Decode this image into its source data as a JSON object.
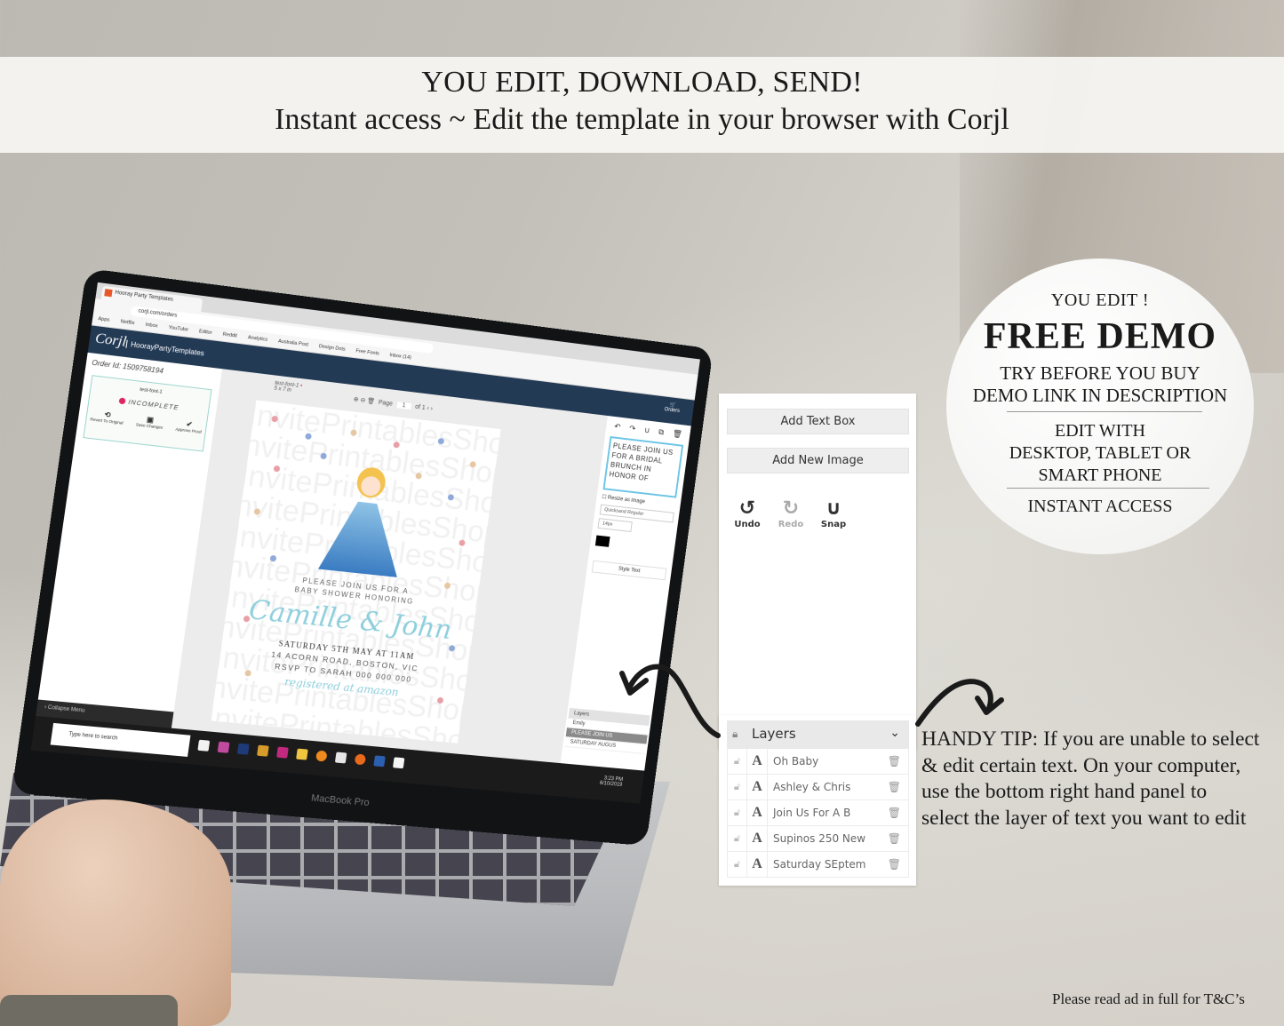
{
  "banner": {
    "line1": "YOU EDIT, DOWNLOAD, SEND!",
    "line2": "Instant access ~ Edit the template in your browser with Corjl"
  },
  "badge": {
    "line1": "YOU EDIT !",
    "line2": "FREE DEMO",
    "line3": "TRY BEFORE YOU BUY",
    "line4": "DEMO LINK IN DESCRIPTION",
    "line5": "EDIT WITH",
    "line6": "DESKTOP, TABLET OR",
    "line7": "SMART PHONE",
    "line8": "INSTANT ACCESS"
  },
  "editor_panel": {
    "add_text_box": "Add Text Box",
    "add_new_image": "Add New Image",
    "tools": [
      {
        "icon": "undo-icon",
        "label": "Undo",
        "enabled": true
      },
      {
        "icon": "redo-icon",
        "label": "Redo",
        "enabled": false
      },
      {
        "icon": "magnet-icon",
        "label": "Snap",
        "enabled": true
      }
    ]
  },
  "layers_panel": {
    "title": "Layers",
    "rows": [
      {
        "name": "Oh Baby"
      },
      {
        "name": "Ashley & Chris"
      },
      {
        "name": "Join Us For A B"
      },
      {
        "name": "Supinos 250 New"
      },
      {
        "name": "Saturday SEptem"
      }
    ]
  },
  "tip": {
    "lines": [
      "HANDY TIP: If you are unable to select",
      "& edit certain text. On your computer,",
      "use the bottom right hand panel to",
      "select the layer of text you want to edit"
    ]
  },
  "terms": "Please read ad in full for T&C’s",
  "laptop_screen": {
    "app_logo": "Corjl",
    "store_name": "HoorayPartyTemplates",
    "orders_label": "Orders",
    "order_id": "Order Id: 1509758194",
    "status_card": {
      "file_name": "test-font-1",
      "status": "INCOMPLETE",
      "actions": [
        "Revert To Original",
        "Save Changes",
        "Approve Proof"
      ]
    },
    "doc_title": "test-font-1",
    "doc_size": "5 x 7 in",
    "page_label": "Page",
    "page_current": "1",
    "page_total": "of 1",
    "collapse_menu": "Collapse Menu",
    "taskbar_search": "Type here to search",
    "clock_time": "3:23 PM",
    "clock_date": "6/10/2019",
    "brand": "MacBook Pro",
    "right_tools": {
      "icons": [
        "Undo",
        "Redo",
        "Snap",
        "Duplicate",
        "Delete"
      ],
      "text_box": "PLEASE JOIN US FOR A BRIDAL BRUNCH IN HONOR OF",
      "resize_label": "Resize as image",
      "font": "Quicksand Regular",
      "size": "14px",
      "style_text": "Style Text",
      "layers_title": "Layers",
      "layers": [
        "Emily",
        "PLEASE JOIN US",
        "SATURDAY AUGUS"
      ]
    },
    "invite": {
      "watermark": "InvitePrintablesShop",
      "line1": "PLEASE JOIN US FOR A",
      "line2": "BABY SHOWER HONORING",
      "names": "Camille & John",
      "line3": "SATURDAY 5TH MAY AT 11AM",
      "line4": "14 ACORN ROAD, BOSTON, VIC",
      "line5": "RSVP TO SARAH 000 000 000",
      "line6": "registered at amazon"
    },
    "browser": {
      "tab_title": "Hooray Party Templates",
      "url": "corjl.com/orders",
      "bookmarks": [
        "Apps",
        "Netflix",
        "Inbox",
        "YouTube",
        "Editor",
        "Reddit",
        "Analytics",
        "Australia Post",
        "Design Dots",
        "Free Fonts",
        "Inbox (14)"
      ]
    }
  },
  "colors": {
    "banner_bg": "#f6f5f2",
    "app_header": "#233a55",
    "text_box_border": "#6cc5e6",
    "incomplete_dot": "#e0245e",
    "invite_script": "#8ecfdc",
    "panel_button_bg": "#eeeeee"
  }
}
